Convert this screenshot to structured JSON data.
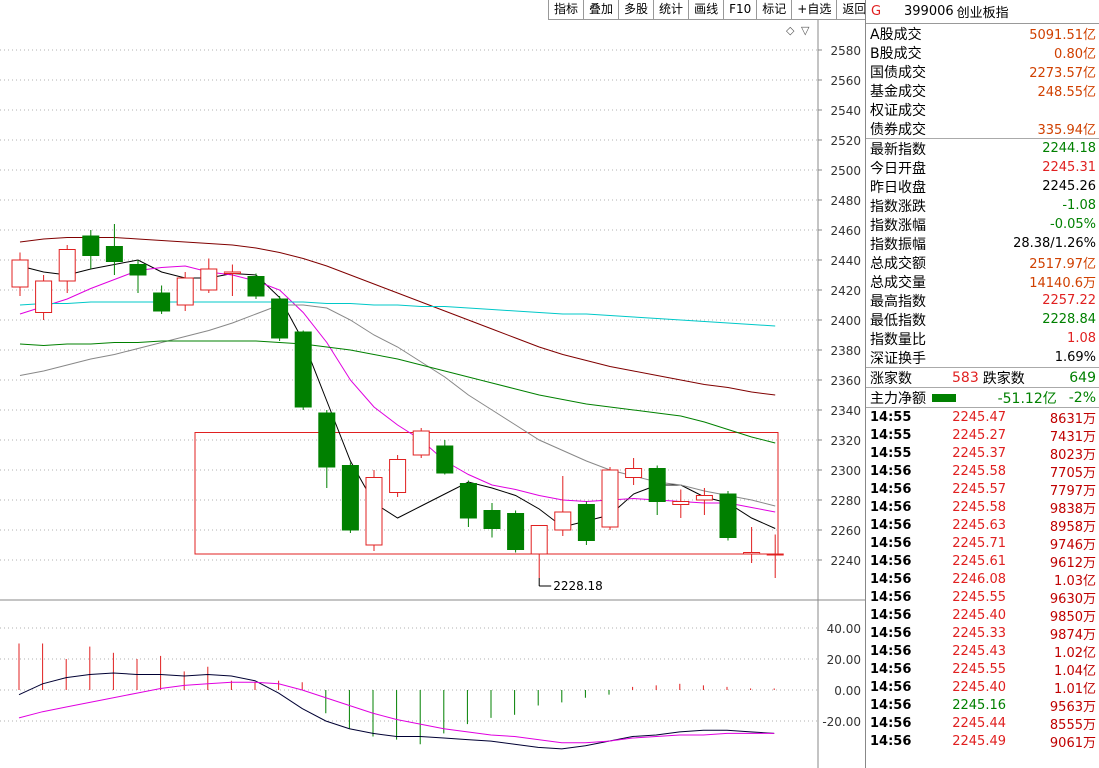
{
  "toolbar": [
    "指标",
    "叠加",
    "多股",
    "统计",
    "画线",
    "F10",
    "标记",
    "+自选",
    "返回"
  ],
  "chart_data": {
    "type": "candlestick",
    "y_ticks": [
      2580,
      2560,
      2540,
      2520,
      2500,
      2480,
      2460,
      2440,
      2420,
      2400,
      2380,
      2360,
      2340,
      2320,
      2300,
      2280,
      2260,
      2240
    ],
    "ylim": [
      2228,
      2590
    ],
    "candles": [
      {
        "o": 2422,
        "h": 2445,
        "l": 2416,
        "c": 2440
      },
      {
        "o": 2405,
        "h": 2430,
        "l": 2400,
        "c": 2426
      },
      {
        "o": 2426,
        "h": 2450,
        "l": 2418,
        "c": 2447
      },
      {
        "o": 2456,
        "h": 2460,
        "l": 2434,
        "c": 2443
      },
      {
        "o": 2449,
        "h": 2464,
        "l": 2430,
        "c": 2439
      },
      {
        "o": 2437,
        "h": 2440,
        "l": 2418,
        "c": 2430
      },
      {
        "o": 2418,
        "h": 2423,
        "l": 2404,
        "c": 2406
      },
      {
        "o": 2410,
        "h": 2432,
        "l": 2406,
        "c": 2428
      },
      {
        "o": 2420,
        "h": 2441,
        "l": 2418,
        "c": 2434
      },
      {
        "o": 2431,
        "h": 2437,
        "l": 2416,
        "c": 2432
      },
      {
        "o": 2429,
        "h": 2431,
        "l": 2414,
        "c": 2416
      },
      {
        "o": 2414,
        "h": 2416,
        "l": 2386,
        "c": 2388
      },
      {
        "o": 2392,
        "h": 2393,
        "l": 2340,
        "c": 2342
      },
      {
        "o": 2338,
        "h": 2340,
        "l": 2288,
        "c": 2302
      },
      {
        "o": 2303,
        "h": 2305,
        "l": 2258,
        "c": 2260
      },
      {
        "o": 2250,
        "h": 2300,
        "l": 2246,
        "c": 2295
      },
      {
        "o": 2285,
        "h": 2310,
        "l": 2282,
        "c": 2307
      },
      {
        "o": 2310,
        "h": 2328,
        "l": 2308,
        "c": 2326
      },
      {
        "o": 2316,
        "h": 2320,
        "l": 2297,
        "c": 2298
      },
      {
        "o": 2291,
        "h": 2293,
        "l": 2262,
        "c": 2268
      },
      {
        "o": 2273,
        "h": 2278,
        "l": 2255,
        "c": 2261
      },
      {
        "o": 2271,
        "h": 2273,
        "l": 2245,
        "c": 2247
      },
      {
        "o": 2244,
        "h": 2262,
        "l": 2228,
        "c": 2263
      },
      {
        "o": 2260,
        "h": 2296,
        "l": 2256,
        "c": 2272
      },
      {
        "o": 2277,
        "h": 2279,
        "l": 2250,
        "c": 2253
      },
      {
        "o": 2262,
        "h": 2302,
        "l": 2260,
        "c": 2300
      },
      {
        "o": 2295,
        "h": 2308,
        "l": 2290,
        "c": 2301
      },
      {
        "o": 2301,
        "h": 2303,
        "l": 2270,
        "c": 2279
      },
      {
        "o": 2277,
        "h": 2287,
        "l": 2268,
        "c": 2279
      },
      {
        "o": 2280,
        "h": 2288,
        "l": 2270,
        "c": 2283
      },
      {
        "o": 2284,
        "h": 2286,
        "l": 2253,
        "c": 2255
      },
      {
        "o": 2244,
        "h": 2262,
        "l": 2238,
        "c": 2245
      },
      {
        "o": 2244,
        "h": 2257,
        "l": 2228,
        "c": 2244
      }
    ],
    "ma": [
      {
        "color": "#000000",
        "values": [
          2436,
          2432,
          2430,
          2434,
          2437,
          2440,
          2432,
          2428,
          2428,
          2431,
          2430,
          2415,
          2386,
          2346,
          2306,
          2278,
          2268,
          2276,
          2284,
          2292,
          2288,
          2283,
          2274,
          2262,
          2266,
          2270,
          2284,
          2290,
          2290,
          2282,
          2278,
          2268,
          2261
        ]
      },
      {
        "color": "#e000e0",
        "values": [
          2404,
          2409,
          2414,
          2421,
          2427,
          2433,
          2435,
          2436,
          2432,
          2430,
          2426,
          2420,
          2405,
          2385,
          2360,
          2342,
          2330,
          2320,
          2306,
          2297,
          2290,
          2287,
          2283,
          2280,
          2279,
          2280,
          2281,
          2280,
          2279,
          2278,
          2278,
          2275,
          2272
        ]
      },
      {
        "color": "#888888",
        "values": [
          2363,
          2366,
          2370,
          2374,
          2377,
          2381,
          2385,
          2389,
          2393,
          2398,
          2404,
          2410,
          2410,
          2408,
          2400,
          2390,
          2382,
          2372,
          2362,
          2350,
          2340,
          2330,
          2320,
          2313,
          2306,
          2300,
          2296,
          2292,
          2290,
          2286,
          2283,
          2280,
          2276
        ]
      },
      {
        "color": "#008000",
        "values": [
          2384,
          2383,
          2384,
          2384,
          2385,
          2385,
          2386,
          2386,
          2386,
          2386,
          2386,
          2385,
          2384,
          2382,
          2380,
          2377,
          2374,
          2370,
          2366,
          2362,
          2358,
          2354,
          2350,
          2347,
          2344,
          2342,
          2340,
          2338,
          2336,
          2332,
          2327,
          2322,
          2318
        ]
      },
      {
        "color": "#800000",
        "values": [
          2452,
          2454,
          2455,
          2455,
          2455,
          2454,
          2453,
          2452,
          2451,
          2450,
          2448,
          2445,
          2441,
          2436,
          2430,
          2424,
          2418,
          2412,
          2406,
          2400,
          2394,
          2388,
          2382,
          2377,
          2373,
          2369,
          2366,
          2363,
          2360,
          2357,
          2355,
          2352,
          2350
        ]
      },
      {
        "color": "#00c8c8",
        "values": [
          2410,
          2411,
          2411,
          2412,
          2412,
          2412,
          2412,
          2412,
          2412,
          2412,
          2412,
          2412,
          2412,
          2411,
          2411,
          2410,
          2410,
          2409,
          2409,
          2408,
          2407,
          2406,
          2405,
          2404,
          2404,
          2403,
          2402,
          2401,
          2400,
          2399,
          2398,
          2397,
          2396
        ]
      }
    ],
    "low_annotation": "2228.18",
    "macd": {
      "ylim": [
        -32,
        60
      ],
      "y_ticks": [
        40.0,
        20.0,
        0.0,
        -20.0
      ],
      "bars": [
        30,
        30,
        20,
        28,
        24,
        20,
        22,
        12,
        15,
        6,
        5,
        6,
        5,
        -15,
        -25,
        -30,
        -32,
        -35,
        -28,
        -22,
        -18,
        -16,
        -10,
        -8,
        -5,
        -3,
        2,
        3,
        4,
        3,
        2,
        1,
        1
      ],
      "dif": [
        -3,
        4,
        8,
        10,
        11,
        10,
        10,
        9,
        10,
        9,
        6,
        -2,
        -12,
        -20,
        -25,
        -28,
        -30,
        -30,
        -31,
        -32,
        -33,
        -35,
        -37,
        -38,
        -36,
        -33,
        -30,
        -29,
        -27,
        -26,
        -26,
        -27,
        -28
      ],
      "dea": [
        -18,
        -14,
        -11,
        -8,
        -5,
        -2,
        1,
        3,
        4,
        5,
        5,
        4,
        0,
        -5,
        -10,
        -15,
        -19,
        -22,
        -25,
        -27,
        -29,
        -30,
        -32,
        -34,
        -34,
        -33,
        -31,
        -30,
        -29,
        -29,
        -28,
        -28,
        -28
      ]
    }
  },
  "panel": {
    "g_mark": "G",
    "code": "399006",
    "name": "创业板指",
    "volumes": [
      {
        "label": "A股成交",
        "value": "5091.51亿"
      },
      {
        "label": "B股成交",
        "value": "0.80亿"
      },
      {
        "label": "国债成交",
        "value": "2273.57亿"
      },
      {
        "label": "基金成交",
        "value": "248.55亿"
      },
      {
        "label": "权证成交",
        "value": ""
      },
      {
        "label": "债券成交",
        "value": "335.94亿"
      }
    ],
    "stats": [
      {
        "label": "最新指数",
        "value": "2244.18",
        "cls": "green"
      },
      {
        "label": "今日开盘",
        "value": "2245.31",
        "cls": "red"
      },
      {
        "label": "昨日收盘",
        "value": "2245.26",
        "cls": "blk"
      },
      {
        "label": "指数涨跌",
        "value": "-1.08",
        "cls": "green"
      },
      {
        "label": "指数涨幅",
        "value": "-0.05%",
        "cls": "green"
      },
      {
        "label": "指数振幅",
        "value": "28.38/1.26%",
        "cls": "blk"
      },
      {
        "label": "总成交额",
        "value": "2517.97亿",
        "cls": "orange"
      },
      {
        "label": "总成交量",
        "value": "14140.6万",
        "cls": "orange"
      },
      {
        "label": "最高指数",
        "value": "2257.22",
        "cls": "red"
      },
      {
        "label": "最低指数",
        "value": "2228.84",
        "cls": "green"
      },
      {
        "label": "指数量比",
        "value": "1.08",
        "cls": "red"
      },
      {
        "label": "深证换手",
        "value": "1.69%",
        "cls": "blk"
      }
    ],
    "rise_label": "涨家数",
    "rise_value": "583",
    "fall_label": "跌家数",
    "fall_value": "649",
    "mainforce_label": "主力净额",
    "mainforce_value": "-51.12亿",
    "mainforce_pct": "-2%",
    "ticks": [
      {
        "t": "14:55",
        "p": "2245.47",
        "v": "8631万",
        "pc": "red"
      },
      {
        "t": "14:55",
        "p": "2245.27",
        "v": "7431万",
        "pc": "red"
      },
      {
        "t": "14:55",
        "p": "2245.37",
        "v": "8023万",
        "pc": "red"
      },
      {
        "t": "14:56",
        "p": "2245.58",
        "v": "7705万",
        "pc": "red"
      },
      {
        "t": "14:56",
        "p": "2245.57",
        "v": "7797万",
        "pc": "red"
      },
      {
        "t": "14:56",
        "p": "2245.58",
        "v": "9838万",
        "pc": "red"
      },
      {
        "t": "14:56",
        "p": "2245.63",
        "v": "8958万",
        "pc": "red"
      },
      {
        "t": "14:56",
        "p": "2245.71",
        "v": "9746万",
        "pc": "red"
      },
      {
        "t": "14:56",
        "p": "2245.61",
        "v": "9612万",
        "pc": "red"
      },
      {
        "t": "14:56",
        "p": "2246.08",
        "v": "1.03亿",
        "pc": "red"
      },
      {
        "t": "14:56",
        "p": "2245.55",
        "v": "9630万",
        "pc": "red"
      },
      {
        "t": "14:56",
        "p": "2245.40",
        "v": "9850万",
        "pc": "red"
      },
      {
        "t": "14:56",
        "p": "2245.33",
        "v": "9874万",
        "pc": "red"
      },
      {
        "t": "14:56",
        "p": "2245.43",
        "v": "1.02亿",
        "pc": "red"
      },
      {
        "t": "14:56",
        "p": "2245.55",
        "v": "1.04亿",
        "pc": "red"
      },
      {
        "t": "14:56",
        "p": "2245.40",
        "v": "1.01亿",
        "pc": "red"
      },
      {
        "t": "14:56",
        "p": "2245.16",
        "v": "9563万",
        "pc": "green"
      },
      {
        "t": "14:56",
        "p": "2245.44",
        "v": "8555万",
        "pc": "red"
      },
      {
        "t": "14:56",
        "p": "2245.49",
        "v": "9061万",
        "pc": "red"
      }
    ]
  }
}
